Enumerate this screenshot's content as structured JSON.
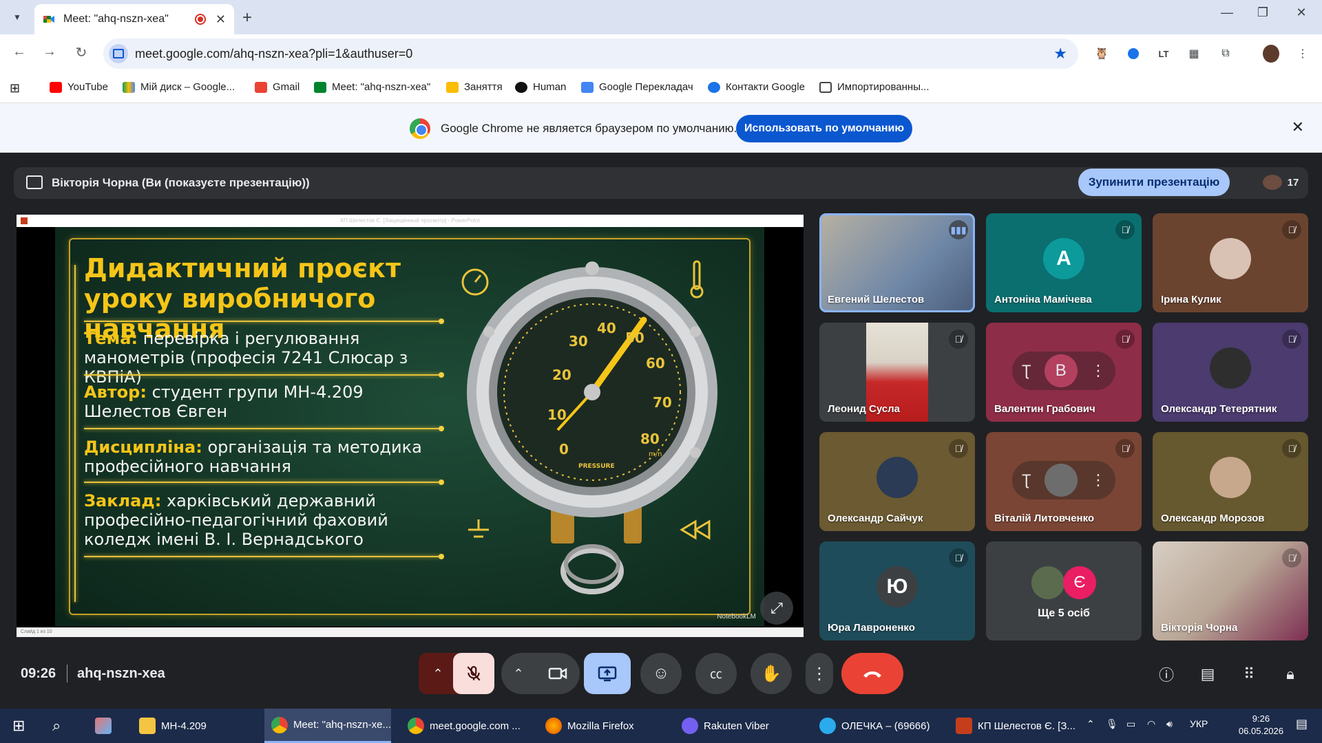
{
  "browser": {
    "tab_title": "Meet: \"ahq-nszn-xea\"",
    "url": "meet.google.com/ahq-nszn-xea?pli=1&authuser=0",
    "bookmarks": [
      "YouTube",
      "Мій диск – Google...",
      "Gmail",
      "Meet: \"ahq-nszn-xea\"",
      "Заняття",
      "Human",
      "Google Перекладач",
      "Контакти Google",
      "Импортированны..."
    ],
    "infobar_text": "Google Chrome не является браузером по умолчанию.",
    "infobar_button": "Использовать по умолчанию"
  },
  "meet": {
    "presenter_text": "Вікторія Чорна (Ви (показуєте презентацію))",
    "stop_button": "Зупинити презентацію",
    "participant_count": "17",
    "time": "09:26",
    "meeting_code": "ahq-nszn-xea"
  },
  "slide": {
    "window_title": "КП Шелестов Є. [Защищенный просмотр] - PowerPoint",
    "title": "Дидактичний проєкт уроку виробничого навчання",
    "topic_key": "Тема:",
    "topic_value": "перевірка і регулювання манометрів (професія 7241 Слюсар з КВПіА)",
    "author_key": "Автор:",
    "author_value": "студент групи МН-4.209 Шелестов Євген",
    "discipline_key": "Дисципліна:",
    "discipline_value": "організація та методика професійного навчання",
    "institution_key": "Заклад:",
    "institution_value": "харківський державний професійно-педагогічний фаховий коледж імені В. І. Вернадського",
    "gauge_label": "PRESSURE",
    "gauge_unit": "m/n",
    "gauge_ticks": [
      "0",
      "10",
      "20",
      "30",
      "40",
      "50",
      "60",
      "70",
      "80"
    ],
    "watermark": "NotebookLM",
    "status": "Слайд 1 из 10"
  },
  "participants": [
    {
      "name": "Евгений Шелестов",
      "initial": "",
      "color": "#8a8f99",
      "muted": false,
      "speaking": true
    },
    {
      "name": "Антоніна Мамічева",
      "initial": "А",
      "color": "#0b6f70",
      "muted": true
    },
    {
      "name": "Ірина Кулик",
      "initial": "",
      "color": "#6b4430",
      "muted": true
    },
    {
      "name": "Леонид Сусла",
      "initial": "",
      "color": "#3c4043",
      "muted": true
    },
    {
      "name": "Валентин Грабович",
      "initial": "В",
      "color": "#8e2d48",
      "muted": true
    },
    {
      "name": "Олександр Тетерятник",
      "initial": "",
      "color": "#4b3b6e",
      "muted": true
    },
    {
      "name": "Олександр Сайчук",
      "initial": "",
      "color": "#6b5a32",
      "muted": true
    },
    {
      "name": "Віталій Литовченко",
      "initial": "",
      "color": "#7a4535",
      "muted": true
    },
    {
      "name": "Олександр Морозов",
      "initial": "",
      "color": "#66582f",
      "muted": true
    },
    {
      "name": "Юра Лавроненко",
      "initial": "Ю",
      "color": "#1f4c5a",
      "muted": true
    },
    {
      "name": "Ще 5 осіб",
      "initial": "Є",
      "color": "#3c4043",
      "muted": false
    },
    {
      "name": "Вікторія Чорна",
      "initial": "",
      "color": "#c9b8a8",
      "muted": true
    }
  ],
  "pin_symbol": "Ʈ",
  "taskbar": {
    "items": [
      "МН-4.209",
      "Meet: \"ahq-nszn-xe...",
      "meet.google.com ...",
      "Mozilla Firefox",
      "Rakuten Viber",
      "ОЛЕЧКА – (69666)",
      "КП Шелестов Є. [З..."
    ],
    "lang": "УКР",
    "time": "9:26",
    "date": "06.05.2026"
  },
  "colors": {
    "meet_bg": "#202124",
    "accent": "#a8c7fa",
    "end_call": "#ea4335",
    "slide_yellow": "#f5c518"
  },
  "icons": [
    "search-icon",
    "microphone-off-icon",
    "camera-icon",
    "present-icon",
    "emoji-icon",
    "captions-icon",
    "hand-icon",
    "more-icon",
    "end-call-icon",
    "info-icon",
    "chat-icon",
    "apps-icon",
    "lock-icon"
  ]
}
